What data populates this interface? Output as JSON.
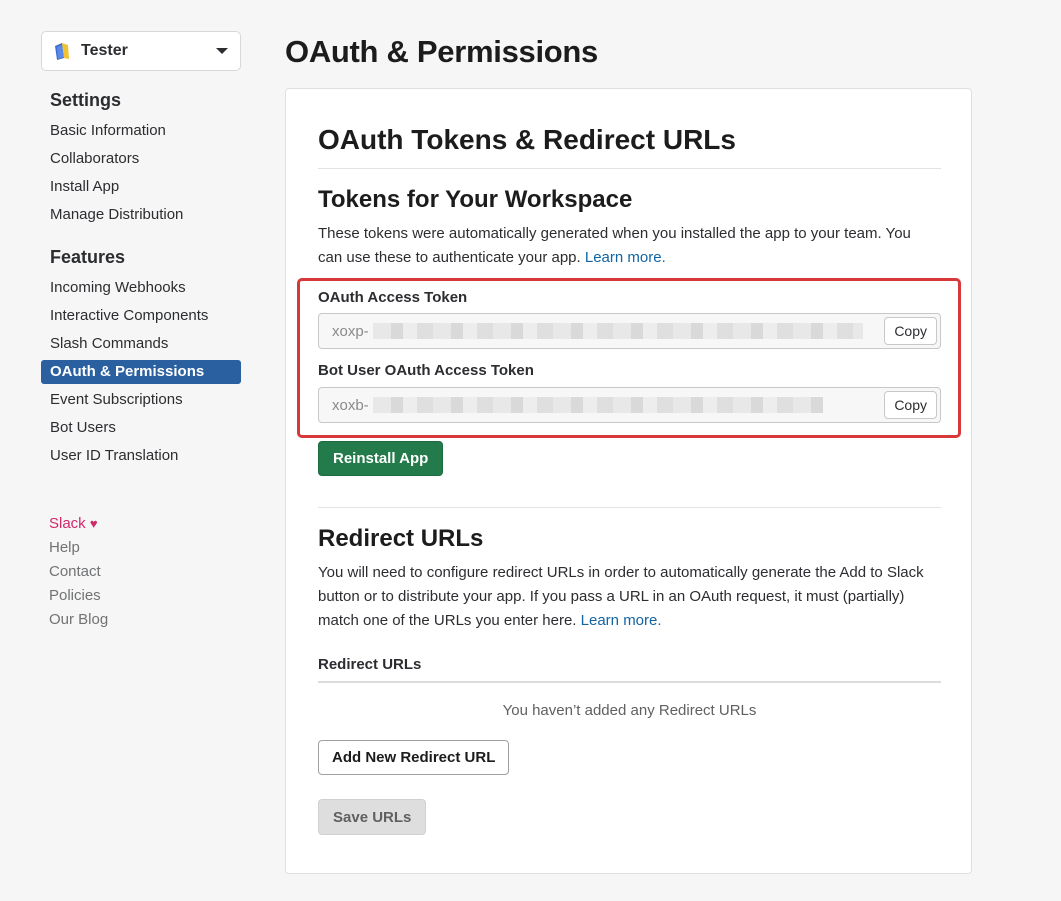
{
  "app_switcher": {
    "name": "Tester",
    "icon": "book-icon"
  },
  "sidebar": {
    "settings_heading": "Settings",
    "settings_items": [
      "Basic Information",
      "Collaborators",
      "Install App",
      "Manage Distribution"
    ],
    "features_heading": "Features",
    "features_items": [
      "Incoming Webhooks",
      "Interactive Components",
      "Slash Commands",
      "OAuth & Permissions",
      "Event Subscriptions",
      "Bot Users",
      "User ID Translation"
    ],
    "active_item": "OAuth & Permissions",
    "footer": {
      "slack": "Slack",
      "links": [
        "Help",
        "Contact",
        "Policies",
        "Our Blog"
      ]
    }
  },
  "page_title": "OAuth & Permissions",
  "oauth_section": {
    "title": "OAuth Tokens & Redirect URLs",
    "tokens_title": "Tokens for Your Workspace",
    "tokens_desc": "These tokens were automatically generated when you installed the app to your team. You can use these to authenticate your app.",
    "learn_more": "Learn more.",
    "access_token_label": "OAuth Access Token",
    "access_token_prefix": "xoxp-",
    "bot_token_label": "Bot User OAuth Access Token",
    "bot_token_prefix": "xoxb-",
    "copy_label": "Copy",
    "reinstall_label": "Reinstall App"
  },
  "redirect_section": {
    "title": "Redirect URLs",
    "desc": "You will need to configure redirect URLs in order to automatically generate the Add to Slack button or to distribute your app. If you pass a URL in an OAuth request, it must (partially) match one of the URLs you enter here.",
    "learn_more": "Learn more.",
    "list_label": "Redirect URLs",
    "empty_message": "You haven’t added any Redirect URLs",
    "add_label": "Add New Redirect URL",
    "save_label": "Save URLs"
  },
  "colors": {
    "active_nav": "#2a5fa0",
    "reinstall": "#237b4b",
    "highlight": "#d9383a",
    "link": "#1264a3"
  }
}
